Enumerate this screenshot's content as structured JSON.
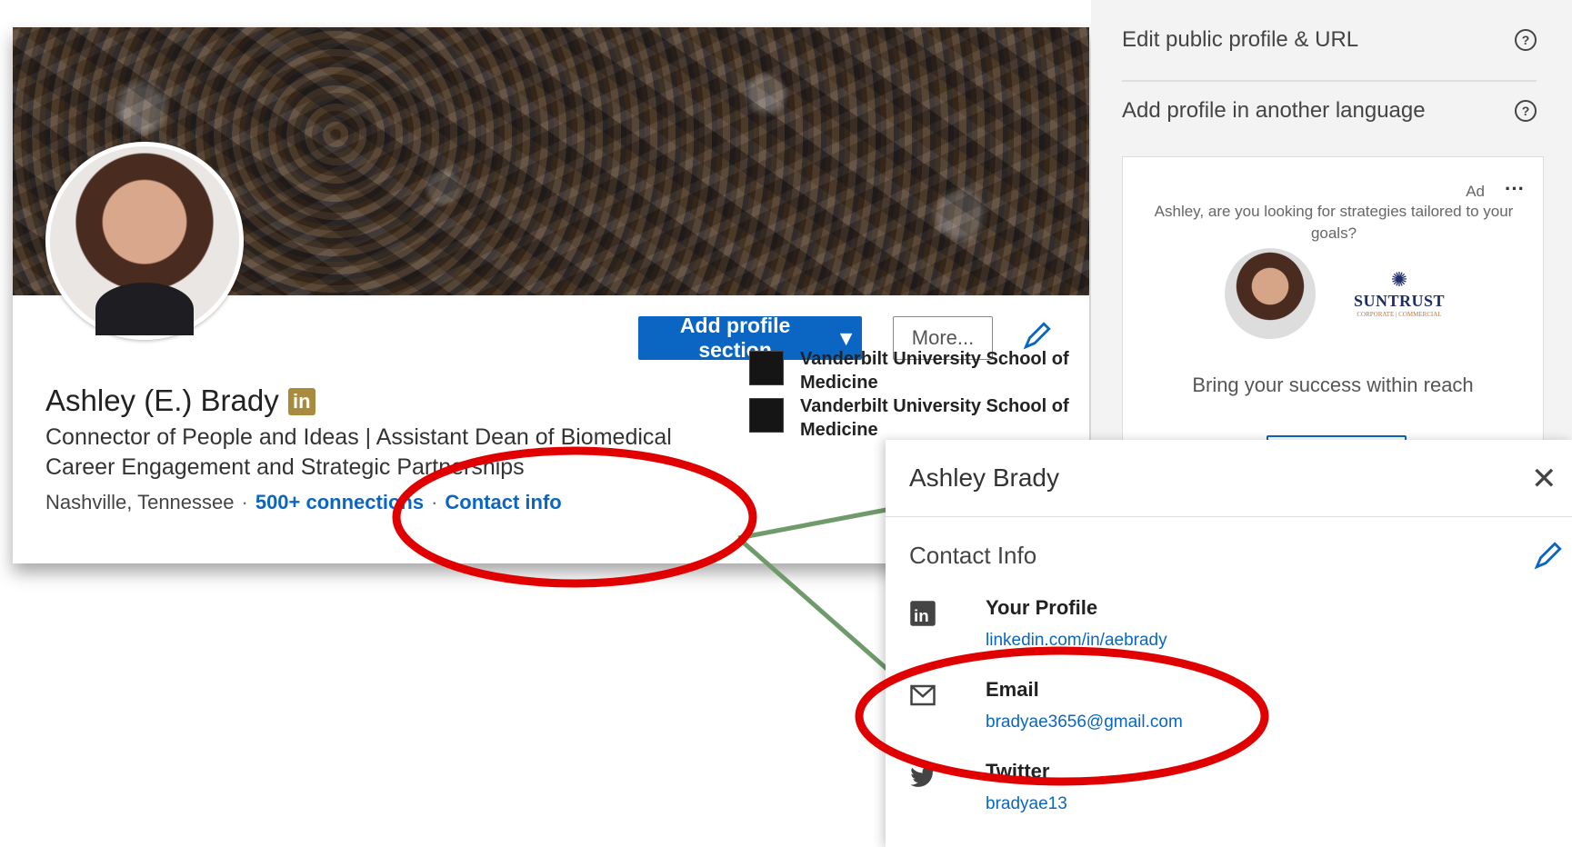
{
  "profile": {
    "name": "Ashley (E.) Brady",
    "badge": "in",
    "headline": "Connector of People and Ideas | Assistant Dean of Biomedical Career Engagement and Strategic Partnerships",
    "location": "Nashville, Tennessee",
    "connections": "500+ connections",
    "contact_info": "Contact info",
    "actions": {
      "add_section": "Add profile section",
      "more": "More..."
    },
    "education": [
      {
        "name": "Vanderbilt University School of Medicine"
      },
      {
        "name": "Vanderbilt University School of Medicine"
      }
    ]
  },
  "sidebar": {
    "edit_public": "Edit public profile & URL",
    "add_language": "Add profile in another language",
    "ad": {
      "label": "Ad",
      "menu": "···",
      "text": "Ashley, are you looking for strategies tailored to your goals?",
      "brand": "SUNTRUST",
      "brand_sub": "CORPORATE | COMMERCIAL",
      "tagline": "Bring your success within reach"
    }
  },
  "contact_popup": {
    "title": "Ashley Brady",
    "close": "✕",
    "heading": "Contact Info",
    "items": [
      {
        "label": "Your Profile",
        "value": "linkedin.com/in/aebrady",
        "icon": "linkedin-icon"
      },
      {
        "label": "Email",
        "value": "bradyae3656@gmail.com",
        "icon": "envelope-icon"
      },
      {
        "label": "Twitter",
        "value": "bradyae13",
        "icon": "twitter-icon"
      }
    ]
  },
  "colors": {
    "accent": "#0a66c2",
    "annotation_circle": "#e00000",
    "connector": "#6f9a6a",
    "badge": "#a88b3c"
  }
}
